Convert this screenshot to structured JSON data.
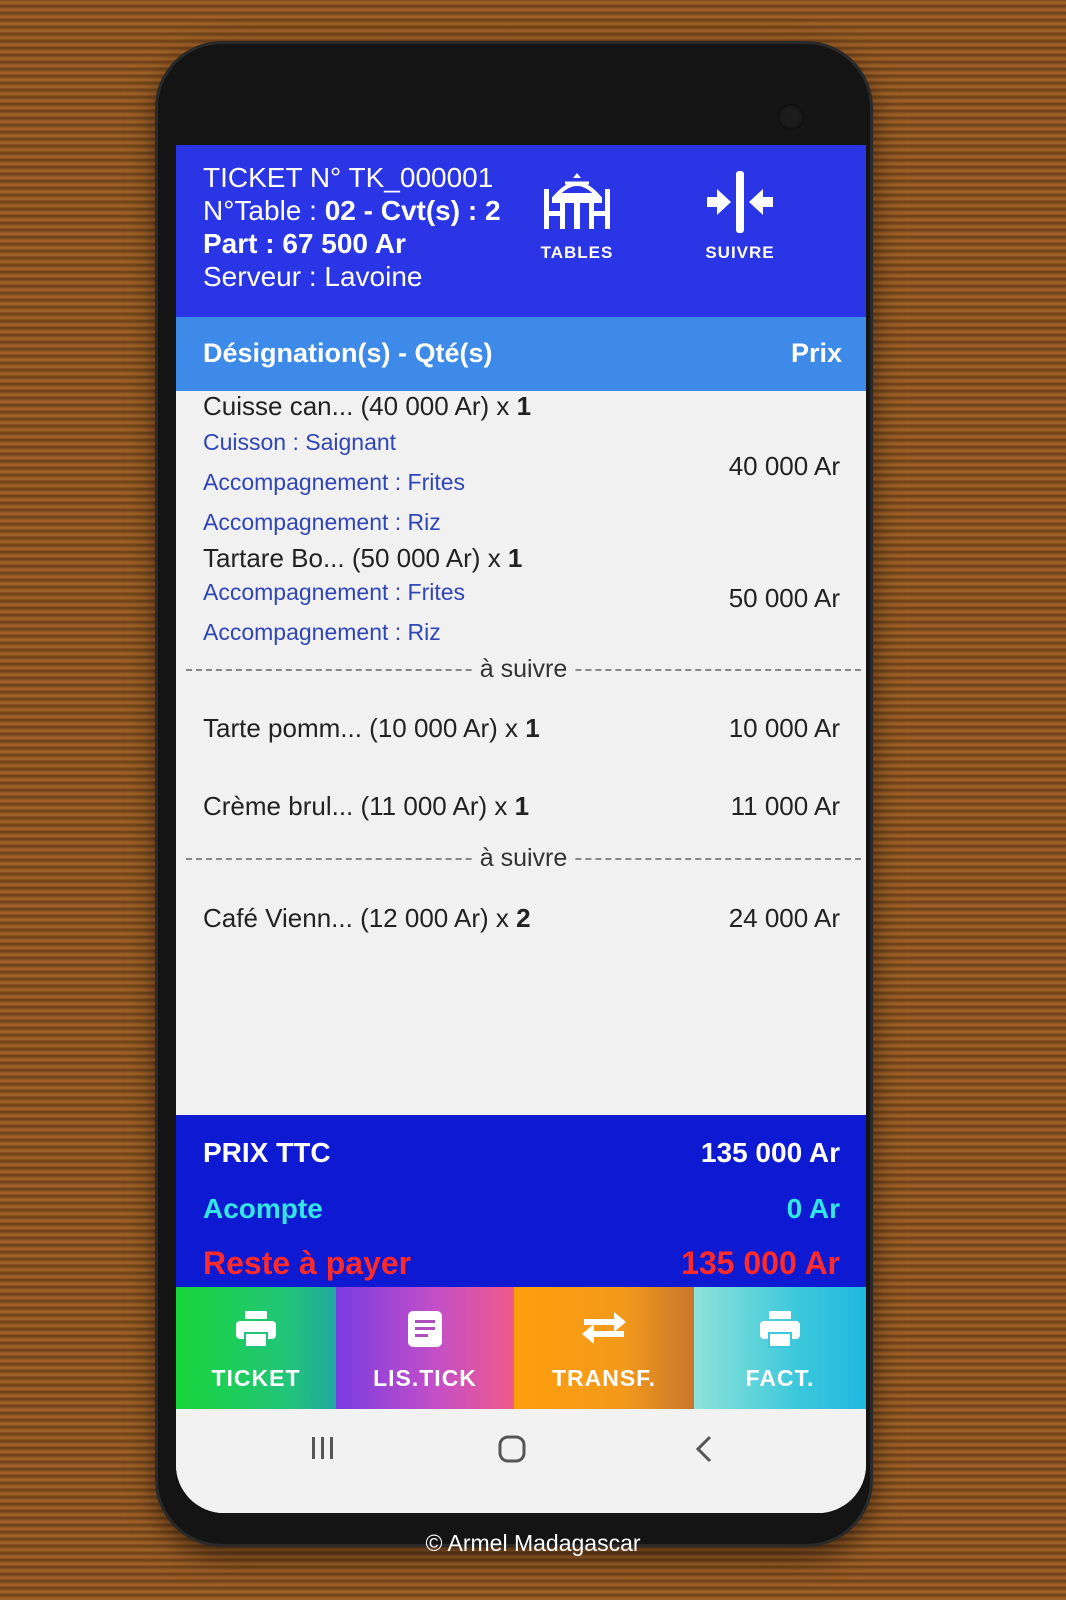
{
  "header": {
    "ticket": "TICKET N° TK_000001",
    "table_prefix": "N°Table : ",
    "table_value": "02 - Cvt(s) : 2",
    "part": "Part : 67 500 Ar",
    "server": "Serveur : Lavoine",
    "tables_label": "TABLES",
    "suivre_label": "SUIVRE"
  },
  "columns": {
    "left": "Désignation(s) - Qté(s)",
    "right": "Prix"
  },
  "items": [
    {
      "name": "Cuisse can... (40 000 Ar) x ",
      "qty": "1",
      "price": "40 000 Ar",
      "options": [
        "Cuisson : Saignant",
        "Accompagnement : Frites",
        "Accompagnement : Riz"
      ]
    },
    {
      "name": "Tartare Bo... (50 000 Ar) x ",
      "qty": "1",
      "price": "50 000 Ar",
      "options": [
        "Accompagnement : Frites",
        "Accompagnement : Riz"
      ]
    },
    {
      "name": "Tarte pomm... (10 000 Ar) x ",
      "qty": "1",
      "price": "10 000 Ar",
      "options": []
    },
    {
      "name": "Crème brul... (11 000 Ar) x ",
      "qty": "1",
      "price": "11 000 Ar",
      "options": []
    },
    {
      "name": "Café Vienn... (12 000 Ar) x ",
      "qty": "2",
      "price": "24 000 Ar",
      "options": []
    }
  ],
  "separator_label": "à suivre",
  "totals": {
    "prix_ttc_label": "PRIX TTC",
    "prix_ttc_value": "135 000 Ar",
    "acompte_label": "Acompte",
    "acompte_value": "0 Ar",
    "reste_label": "Reste à payer",
    "reste_value": "135 000 Ar"
  },
  "buttons": {
    "ticket": "TICKET",
    "list": "LIS.TICK",
    "transfer": "TRANSF.",
    "fact": "FACT."
  },
  "colors": {
    "header_bg": "#2a35e6",
    "column_bg": "#3d8ae8",
    "totals_bg": "#0d1ad2",
    "acompte": "#33e6e6",
    "reste": "#ff2a2a",
    "option_text": "#2f45b8"
  },
  "watermark": "© Armel Madagascar"
}
